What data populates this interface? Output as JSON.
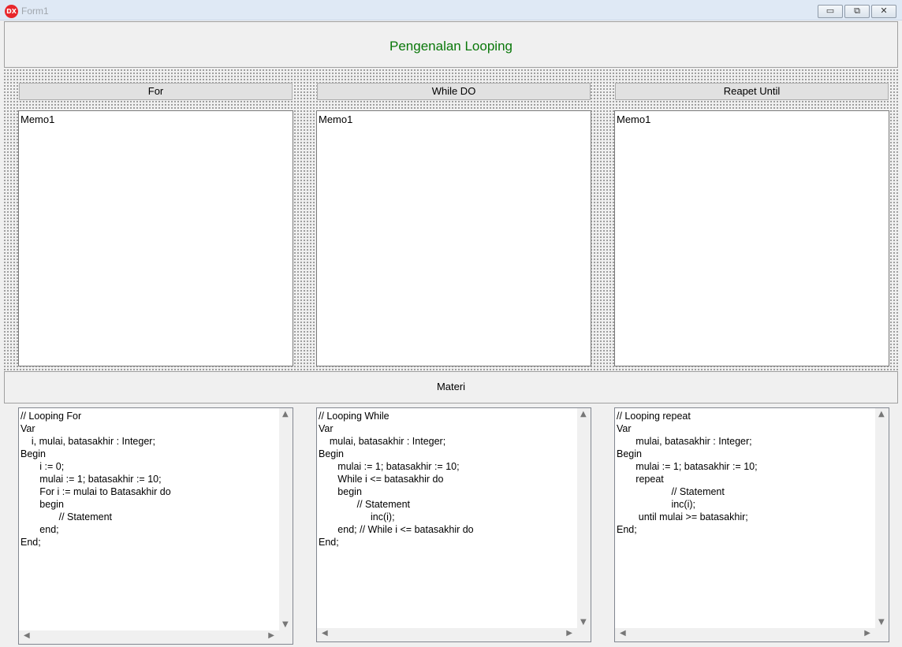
{
  "window": {
    "title": "Form1",
    "icon_text": "DX",
    "minimize": "▭",
    "maximize": "⧉",
    "close": "✕"
  },
  "header": {
    "title": "Pengenalan Looping",
    "title_color": "#0a780a"
  },
  "buttons": {
    "for": "For",
    "while": "While DO",
    "repeat": "Reapet Until"
  },
  "memos": {
    "m1": "Memo1",
    "m2": "Memo1",
    "m3": "Memo1"
  },
  "materi": {
    "label": "Materi"
  },
  "code": {
    "for": [
      "// Looping For",
      "Var",
      "    i, mulai, batasakhir : Integer;",
      "Begin",
      "       i := 0;",
      "       mulai := 1; batasakhir := 10;",
      "       For i := mulai to Batasakhir do",
      "       begin",
      "              // Statement",
      "       end;",
      "End;"
    ],
    "while": [
      "// Looping While",
      "Var",
      "    mulai, batasakhir : Integer;",
      "Begin",
      "       mulai := 1; batasakhir := 10;",
      "       While i <= batasakhir do",
      "       begin",
      "              // Statement",
      "                   inc(i);",
      "       end; // While i <= batasakhir do",
      "End;"
    ],
    "repeat": [
      "// Looping repeat",
      "Var",
      "       mulai, batasakhir : Integer;",
      "Begin",
      "       mulai := 1; batasakhir := 10;",
      "       repeat",
      "                    // Statement",
      "                    inc(i);",
      "        until mulai >= batasakhir;",
      "End;"
    ]
  },
  "icons": {
    "scroll_up": "▲",
    "scroll_down": "▼",
    "scroll_left": "◀",
    "scroll_right": "▶"
  }
}
